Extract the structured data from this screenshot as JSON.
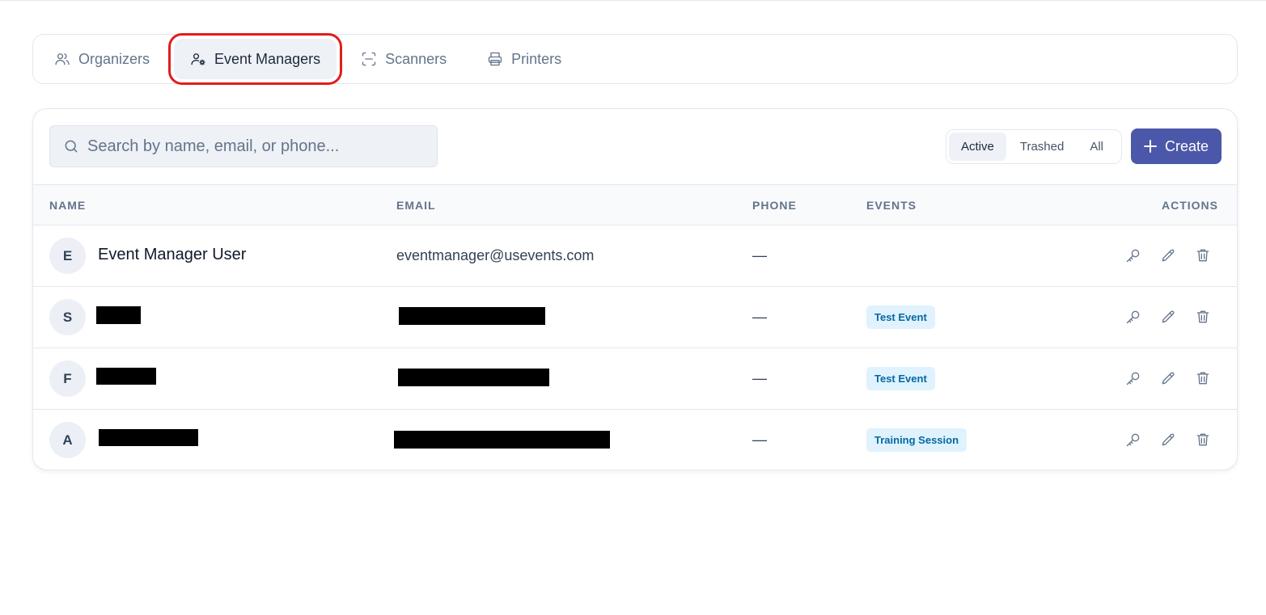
{
  "tabs": [
    {
      "label": "Organizers",
      "icon": "users-icon",
      "selected": false
    },
    {
      "label": "Event Managers",
      "icon": "user-gear-icon",
      "selected": true
    },
    {
      "label": "Scanners",
      "icon": "scan-icon",
      "selected": false
    },
    {
      "label": "Printers",
      "icon": "printer-icon",
      "selected": false
    }
  ],
  "search": {
    "placeholder": "Search by name, email, or phone...",
    "value": ""
  },
  "filters": [
    {
      "label": "Active",
      "selected": true
    },
    {
      "label": "Trashed",
      "selected": false
    },
    {
      "label": "All",
      "selected": false
    }
  ],
  "create_label": "Create",
  "columns": {
    "name": "NAME",
    "email": "EMAIL",
    "phone": "PHONE",
    "events": "EVENTS",
    "actions": "ACTIONS"
  },
  "rows": [
    {
      "initial": "E",
      "name": "Event Manager User",
      "email": "eventmanager@usevents.com",
      "phone": "—",
      "event": ""
    },
    {
      "initial": "S",
      "name": "",
      "email": "",
      "phone": "—",
      "event": "Test Event"
    },
    {
      "initial": "F",
      "name": "",
      "email": "",
      "phone": "—",
      "event": "Test Event"
    },
    {
      "initial": "A",
      "name": "",
      "email": "",
      "phone": "—",
      "event": "Training Session"
    }
  ],
  "colors": {
    "accent": "#4b57a8",
    "highlight_outline": "#e11d1d",
    "badge_bg": "#e0f2fe",
    "badge_text": "#0369a1"
  }
}
